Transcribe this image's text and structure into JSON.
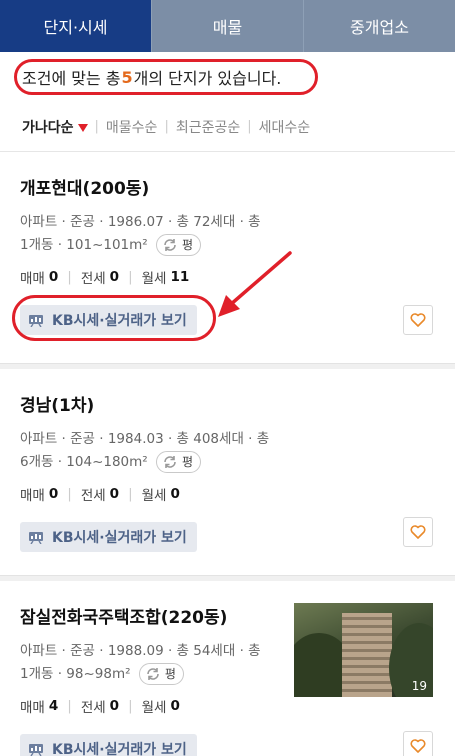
{
  "tabs": [
    {
      "label": "단지·시세",
      "active": true
    },
    {
      "label": "매물",
      "active": false
    },
    {
      "label": "중개업소",
      "active": false
    }
  ],
  "result": {
    "prefix": "조건에 맞는 총 ",
    "count": "5",
    "suffix": "개의 단지가 있습니다."
  },
  "sort": {
    "items": [
      "가나다순",
      "매물수순",
      "최근준공순",
      "세대수순"
    ]
  },
  "pyeong_label": "평",
  "kb_label": "KB시세·실거래가 보기",
  "trade_labels": {
    "sale": "매매",
    "jeonse": "전세",
    "monthly": "월세"
  },
  "complexes": [
    {
      "name": "개포현대(200동)",
      "meta_line1": "아파트 · 준공 · 1986.07 · 총 72세대 · 총",
      "meta_line2": "1개동 · 101~101m²",
      "sale": "0",
      "jeonse": "0",
      "monthly": "11"
    },
    {
      "name": "경남(1차)",
      "meta_line1": "아파트 · 준공 · 1984.03 · 총 408세대 · 총",
      "meta_line2": "6개동 · 104~180m²",
      "sale": "0",
      "jeonse": "0",
      "monthly": "0"
    },
    {
      "name": "잠실전화국주택조합(220동)",
      "meta_line1": "아파트 · 준공 · 1988.09 · 총 54세대 · 총",
      "meta_line2": "1개동 · 98~98m²",
      "sale": "4",
      "jeonse": "0",
      "monthly": "0",
      "photo_count": "19"
    }
  ],
  "colors": {
    "accent_tab": "#173c85",
    "inactive_tab": "#7c8ea6",
    "highlight": "#e46a1d",
    "annotation": "#e0202a"
  }
}
